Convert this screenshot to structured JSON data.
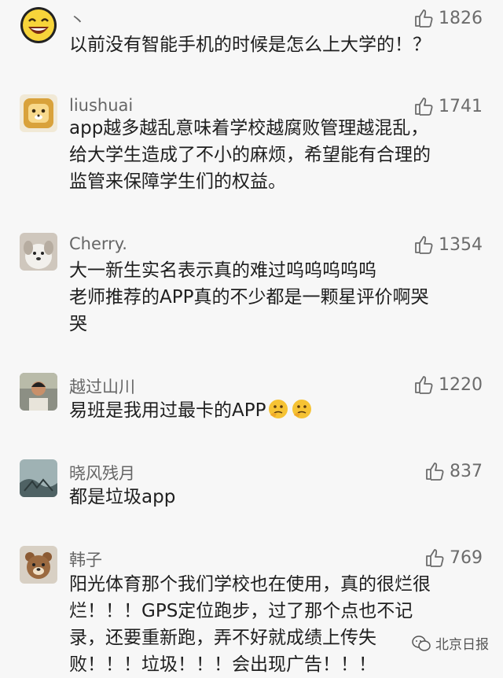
{
  "comments": [
    {
      "username": "丶",
      "likes": "1826",
      "lines": [
        "以前没有智能手机的时候是怎么上大学的！？"
      ]
    },
    {
      "username": "liushuai",
      "likes": "1741",
      "lines": [
        "app越多越乱意味着学校越腐败管理越混乱，",
        "给大学生造成了不小的麻烦，希望能有合理的",
        "监管来保障学生们的权益。"
      ]
    },
    {
      "username": "Cherry.",
      "likes": "1354",
      "lines": [
        "大一新生实名表示真的难过呜呜呜呜呜",
        "老师推荐的APP真的不少都是一颗星评价啊哭",
        "哭"
      ]
    },
    {
      "username": "越过山川",
      "likes": "1220",
      "lines": [
        "易班是我用过最卡的APP"
      ]
    },
    {
      "username": "晓风残月",
      "likes": "837",
      "lines": [
        "都是垃圾app"
      ]
    },
    {
      "username": "韩子",
      "likes": "769",
      "lines": [
        "阳光体育那个我们学校也在使用，真的很烂很",
        "烂！！！GPS定位跑步，过了那个点也不记",
        "录，还要重新跑，弄不好就成绩上传失",
        "败！！！垃圾！！！会出现广告！！！"
      ]
    }
  ],
  "icons": {
    "like": "thumbs-up-icon",
    "emoji": "thinking-face-icon"
  },
  "watermark": "北京日报"
}
